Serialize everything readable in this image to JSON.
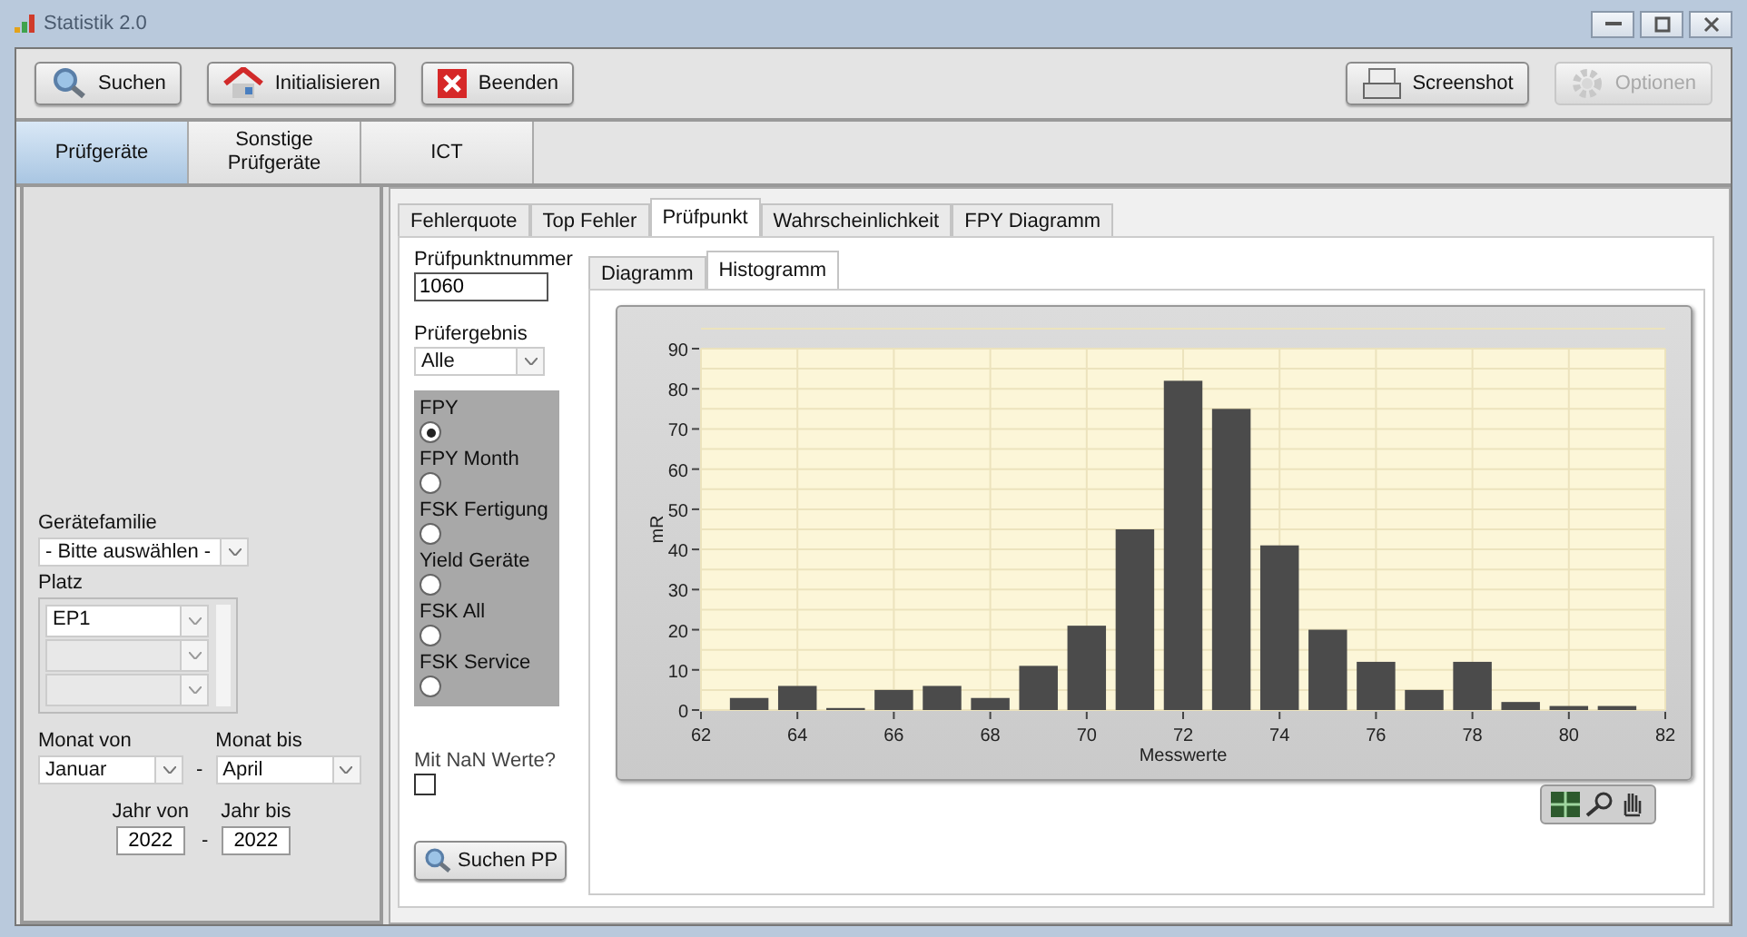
{
  "window": {
    "title": "Statistik 2.0"
  },
  "toolbar": {
    "left_buttons": [
      {
        "label": "Suchen",
        "kind": "search",
        "disabled": false
      },
      {
        "label": "Initialisieren",
        "kind": "home",
        "disabled": false
      },
      {
        "label": "Beenden",
        "kind": "exit",
        "disabled": false
      }
    ],
    "right_buttons": [
      {
        "label": "Screenshot",
        "kind": "screenshot",
        "disabled": false
      },
      {
        "label": "Optionen",
        "kind": "gear",
        "disabled": true
      }
    ]
  },
  "main_tabs": [
    {
      "label": "Prüfgeräte",
      "selected": true
    },
    {
      "label": "Sonstige Prüfgeräte",
      "selected": false
    },
    {
      "label": "ICT",
      "selected": false
    }
  ],
  "filters": {
    "geraetefamilie": {
      "label": "Gerätefamilie",
      "value": "- Bitte auswählen -"
    },
    "platz": {
      "label": "Platz",
      "values": [
        "EP1"
      ]
    },
    "monat_von": {
      "label": "Monat von",
      "value": "Januar"
    },
    "monat_separator": "-",
    "monat_bis": {
      "label": "Monat bis",
      "value": "April"
    },
    "jahr_von": {
      "label": "Jahr von",
      "value": "2022"
    },
    "jahr_separator": "-",
    "jahr_bis": {
      "label": "Jahr bis",
      "value": "2022"
    }
  },
  "tabs": [
    {
      "label": "Fehlerquote",
      "selected": false
    },
    {
      "label": "Top Fehler",
      "selected": false
    },
    {
      "label": "Prüfpunkt",
      "selected": true
    },
    {
      "label": "Wahrscheinlichkeit",
      "selected": false
    },
    {
      "label": "FPY Diagramm",
      "selected": false
    }
  ],
  "pruefpunkt": {
    "nummer": {
      "label": "Prüfpunktnummer",
      "value": "1060"
    },
    "ergebnis": {
      "label": "Prüfergebnis",
      "value": "Alle"
    },
    "modes": [
      {
        "label": "FPY",
        "selected": true
      },
      {
        "label": "FPY Month",
        "selected": false
      },
      {
        "label": "FSK Fertigung",
        "selected": false
      },
      {
        "label": "Yield Geräte",
        "selected": false
      },
      {
        "label": "FSK All",
        "selected": false
      },
      {
        "label": "FSK Service",
        "selected": false
      }
    ],
    "nan": {
      "label": "Mit NaN Werte?",
      "checked": false
    },
    "search_button": {
      "label": "Suchen PP"
    }
  },
  "sub_tabs": [
    {
      "label": "Diagramm",
      "selected": false
    },
    {
      "label": "Histogramm",
      "selected": true
    }
  ],
  "chart_data": {
    "type": "bar",
    "xlabel": "Messwerte",
    "ylabel": "mR",
    "x": [
      63,
      64,
      65,
      66,
      67,
      68,
      69,
      70,
      71,
      72,
      73,
      74,
      75,
      76,
      77,
      78,
      79,
      80,
      81
    ],
    "values": [
      3,
      6,
      0.5,
      5,
      6,
      3,
      11,
      21,
      45,
      82,
      75,
      41,
      20,
      12,
      5,
      12,
      2,
      1,
      1
    ],
    "xlim": [
      62,
      82
    ],
    "ylim": [
      0,
      90
    ],
    "xticks": [
      62,
      64,
      66,
      68,
      70,
      72,
      74,
      76,
      78,
      80,
      82
    ],
    "yticks": [
      0,
      10,
      20,
      30,
      40,
      50,
      60,
      70,
      80,
      90
    ],
    "grid": true
  }
}
